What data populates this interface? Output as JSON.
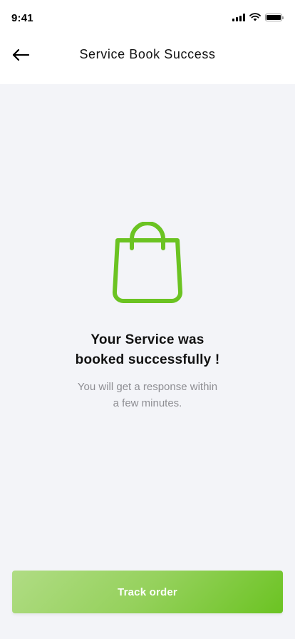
{
  "status_bar": {
    "time": "9:41",
    "icons": [
      "signal-icon",
      "wifi-icon",
      "battery-icon"
    ]
  },
  "header": {
    "back_icon": "arrow-left-icon",
    "title": "Service Book Success"
  },
  "main": {
    "illustration_icon": "shopping-bag-icon",
    "accent_color": "#6bc322",
    "title_line1": "Your Service was",
    "title_line2": "booked successfully !",
    "subtitle_line1": "You will get a response within",
    "subtitle_line2": "a few minutes."
  },
  "footer": {
    "track_button_label": "Track order",
    "button_gradient": [
      "#b0dc84",
      "#6bc322"
    ]
  }
}
